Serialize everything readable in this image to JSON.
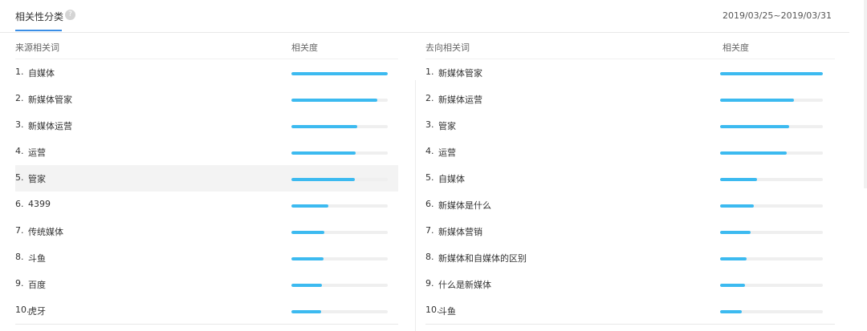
{
  "header": {
    "title": "相关性分类",
    "help_icon": "question-circle-icon",
    "date_range": "2019/03/25~2019/03/31"
  },
  "source": {
    "col_term": "来源相关词",
    "col_relevance": "相关度",
    "items": [
      {
        "idx": "1.",
        "term": "自媒体",
        "relevance": 1.0
      },
      {
        "idx": "2.",
        "term": "新媒体管家",
        "relevance": 0.89
      },
      {
        "idx": "3.",
        "term": "新媒体运营",
        "relevance": 0.68
      },
      {
        "idx": "4.",
        "term": "运营",
        "relevance": 0.67
      },
      {
        "idx": "5.",
        "term": "管家",
        "relevance": 0.66
      },
      {
        "idx": "6.",
        "term": "4399",
        "relevance": 0.38
      },
      {
        "idx": "7.",
        "term": "传统媒体",
        "relevance": 0.34
      },
      {
        "idx": "8.",
        "term": "斗鱼",
        "relevance": 0.33
      },
      {
        "idx": "9.",
        "term": "百度",
        "relevance": 0.32
      },
      {
        "idx": "10.",
        "term": "虎牙",
        "relevance": 0.31
      }
    ]
  },
  "target": {
    "col_term": "去向相关词",
    "col_relevance": "相关度",
    "items": [
      {
        "idx": "1.",
        "term": "新媒体管家",
        "relevance": 1.0
      },
      {
        "idx": "2.",
        "term": "新媒体运营",
        "relevance": 0.72
      },
      {
        "idx": "3.",
        "term": "管家",
        "relevance": 0.67
      },
      {
        "idx": "4.",
        "term": "运营",
        "relevance": 0.65
      },
      {
        "idx": "5.",
        "term": "自媒体",
        "relevance": 0.36
      },
      {
        "idx": "6.",
        "term": "新媒体是什么",
        "relevance": 0.33
      },
      {
        "idx": "7.",
        "term": "新媒体营销",
        "relevance": 0.3
      },
      {
        "idx": "8.",
        "term": "新媒体和自媒体的区别",
        "relevance": 0.26
      },
      {
        "idx": "9.",
        "term": "什么是新媒体",
        "relevance": 0.24
      },
      {
        "idx": "10.",
        "term": "斗鱼",
        "relevance": 0.21
      }
    ]
  },
  "colors": {
    "accent_underline": "#3a8ee6",
    "bar_fill": "#3cbaf0",
    "bar_track": "#efefef",
    "highlight_row": "#f3f3f3"
  },
  "ui_state": {
    "hovered_source_row": 4
  }
}
